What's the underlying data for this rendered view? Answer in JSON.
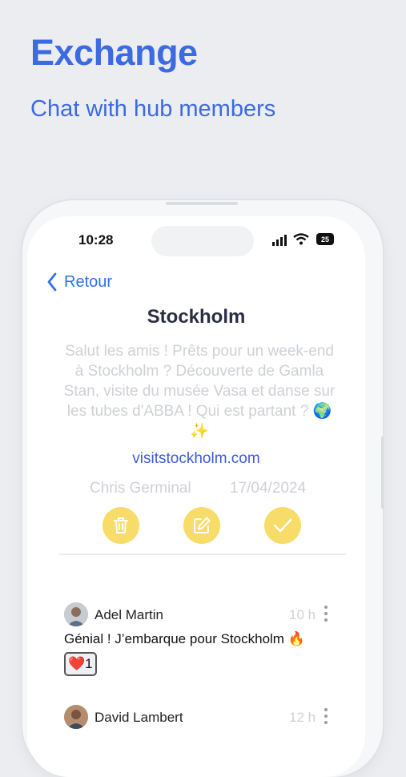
{
  "hero": {
    "title": "Exchange",
    "subtitle": "Chat with hub members"
  },
  "status_bar": {
    "time": "10:28",
    "battery": "25"
  },
  "nav": {
    "back_label": "Retour"
  },
  "topic": {
    "title": "Stockholm",
    "body": "Salut les amis ! Prêts pour un week-end à Stockholm ? Découverte de Gamla Stan, visite du musée Vasa et danse sur les tubes d'ABBA ! Qui est partant ? 🌍✨",
    "link": "visitstockholm.com",
    "author": "Chris Germinal",
    "date": "17/04/2024"
  },
  "actions": {
    "icons": [
      "trash-icon",
      "edit-icon",
      "check-icon"
    ],
    "color": "#f8dc6a"
  },
  "comments": [
    {
      "author": "Adel Martin",
      "time": "10 h",
      "text": "Génial ! J’embarque pour Stockholm 🔥",
      "reaction": {
        "emoji": "❤️",
        "count": "1"
      }
    },
    {
      "author": "David Lambert",
      "time": "12 h"
    }
  ],
  "colors": {
    "accent": "#3c6ae0",
    "link": "#2f72e6",
    "background": "#ebedf1"
  }
}
